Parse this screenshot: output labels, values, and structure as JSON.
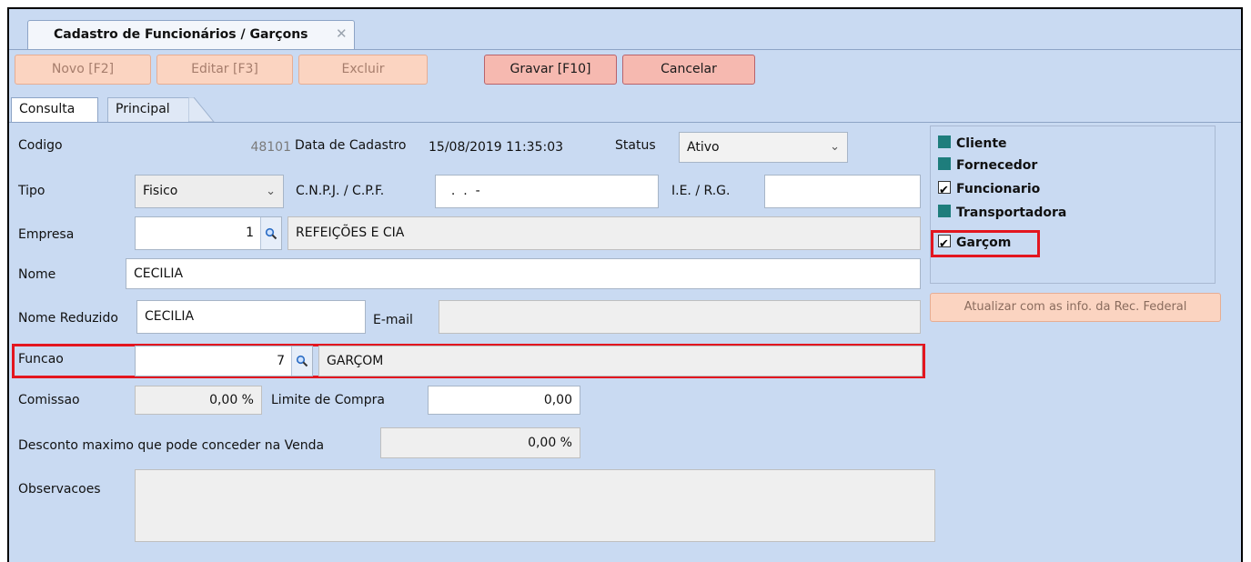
{
  "document_tab": {
    "title": "Cadastro de Funcionários / Garçons",
    "close_icon": "✕"
  },
  "toolbar": {
    "new_label": "Novo [F2]",
    "edit_label": "Editar [F3]",
    "delete_label": "Excluir",
    "save_label": "Gravar [F10]",
    "cancel_label": "Cancelar"
  },
  "page_tabs": {
    "consulta": "Consulta",
    "principal": "Principal"
  },
  "form": {
    "codigo": {
      "label": "Codigo",
      "value": "48101"
    },
    "data_cadastro": {
      "label": "Data de Cadastro",
      "value": "15/08/2019 11:35:03"
    },
    "status": {
      "label": "Status",
      "value": "Ativo"
    },
    "tipo": {
      "label": "Tipo",
      "value": "Fisico"
    },
    "cnpj_cpf": {
      "label": "C.N.P.J. / C.P.F.",
      "value": "  .  .  -"
    },
    "ie_rg": {
      "label": "I.E. / R.G.",
      "value": ""
    },
    "empresa": {
      "label": "Empresa",
      "code": "1",
      "name": "REFEIÇÕES E CIA"
    },
    "nome": {
      "label": "Nome",
      "value": "CECILIA"
    },
    "nome_reduzido": {
      "label": "Nome Reduzido",
      "value": "CECILIA"
    },
    "email": {
      "label": "E-mail",
      "value": ""
    },
    "funcao": {
      "label": "Funcao",
      "code": "7",
      "name": "GARÇOM"
    },
    "comissao": {
      "label": "Comissao",
      "value": "0,00 %"
    },
    "limite_compra": {
      "label": "Limite de Compra",
      "value": "0,00"
    },
    "desconto_maximo": {
      "label": "Desconto maximo que pode conceder na Venda",
      "value": "0,00 %"
    },
    "observacoes": {
      "label": "Observacoes",
      "value": ""
    }
  },
  "categories": [
    {
      "label": "Cliente",
      "checked": false
    },
    {
      "label": "Fornecedor",
      "checked": false
    },
    {
      "label": "Funcionario",
      "checked": true
    },
    {
      "label": "Transportadora",
      "checked": false
    },
    {
      "label": "Garçom",
      "checked": true
    }
  ],
  "update_button_label": "Atualizar com as info. da Rec. Federal",
  "colors": {
    "background": "#c9daf2",
    "highlight": "#e3161f",
    "checkbox": "#1e7d7c",
    "button_active": "#f6b9b0",
    "button_disabled": "#fbd4c1"
  }
}
